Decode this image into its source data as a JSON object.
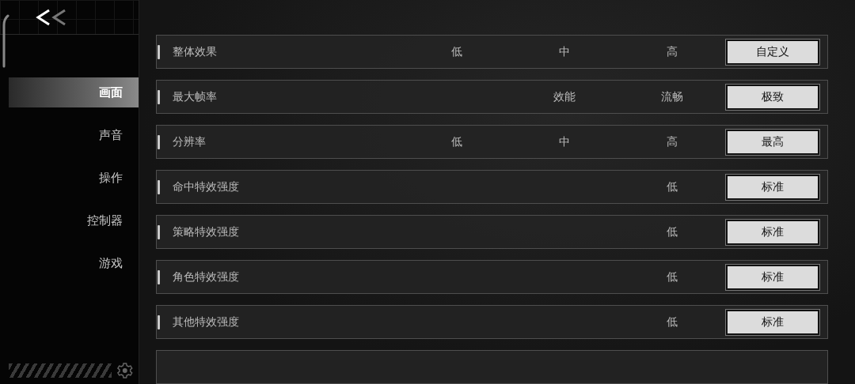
{
  "nav": [
    {
      "label": "画面",
      "selected": true
    },
    {
      "label": "声音",
      "selected": false
    },
    {
      "label": "操作",
      "selected": false
    },
    {
      "label": "控制器",
      "selected": false
    },
    {
      "label": "游戏",
      "selected": false
    }
  ],
  "settings": [
    {
      "label": "整体效果",
      "options": [
        "低",
        "中",
        "高"
      ],
      "value": "自定义"
    },
    {
      "label": "最大帧率",
      "options": [
        "效能",
        "流畅"
      ],
      "value": "极致"
    },
    {
      "label": "分辨率",
      "options": [
        "低",
        "中",
        "高"
      ],
      "value": "最高"
    },
    {
      "label": "命中特效强度",
      "options": [
        "低"
      ],
      "value": "标准"
    },
    {
      "label": "策略特效强度",
      "options": [
        "低"
      ],
      "value": "标准"
    },
    {
      "label": "角色特效强度",
      "options": [
        "低"
      ],
      "value": "标准"
    },
    {
      "label": "其他特效强度",
      "options": [
        "低"
      ],
      "value": "标准"
    }
  ]
}
